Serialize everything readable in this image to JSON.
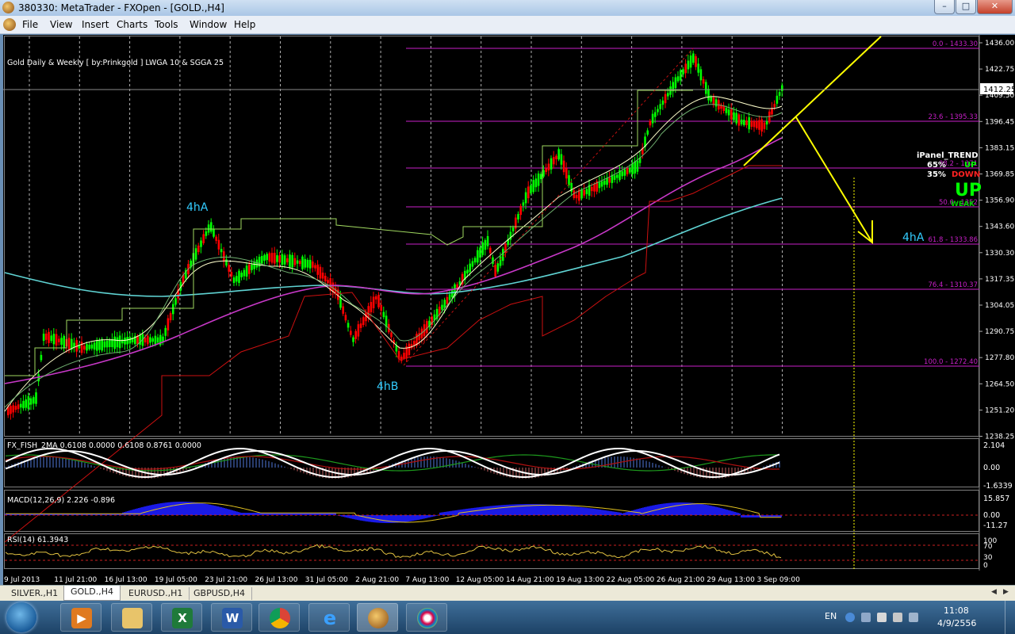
{
  "window": {
    "title": "380330: MetaTrader - FXOpen - [GOLD.,H4]",
    "minimize_label": "–",
    "maximize_label": "□",
    "close_label": "✕"
  },
  "menu": {
    "items": [
      "File",
      "View",
      "Insert",
      "Charts",
      "Tools",
      "Window",
      "Help"
    ]
  },
  "chart": {
    "indicator_title": "Gold Daily & Weekly  [ by:Prinkgold ]  LWGA 10  &  SGGA 25",
    "current_price": "1412.25",
    "price_axis": [
      "1436.00",
      "1422.75",
      "1409.50",
      "1396.45",
      "1383.15",
      "1369.85",
      "1356.90",
      "1343.60",
      "1330.30",
      "1317.35",
      "1304.05",
      "1290.75",
      "1277.80",
      "1264.50",
      "1251.20",
      "1238.25"
    ],
    "date_axis": [
      "9 Jul 2013",
      "11 Jul 21:00",
      "16 Jul 13:00",
      "19 Jul 05:00",
      "23 Jul 21:00",
      "26 Jul 13:00",
      "31 Jul 05:00",
      "2 Aug 21:00",
      "7 Aug 13:00",
      "12 Aug 05:00",
      "14 Aug 21:00",
      "19 Aug 13:00",
      "22 Aug 05:00",
      "26 Aug 21:00",
      "29 Aug 13:00",
      "3 Sep 09:00"
    ],
    "fib_levels": [
      "0.0 - 1433.30",
      "23.6 - 1395.33",
      "38.2 - 1371",
      "50.0 - 1352",
      "61.8 - 1333.86",
      "76.4 - 1310.37",
      "100.0 - 1272.40"
    ],
    "annotations": {
      "top_left": "4hA",
      "right": "4hA",
      "bottom": "4hB"
    },
    "ipanel": {
      "title": "iPanel_TREND",
      "up_pct": "65%",
      "up_label": "UP",
      "down_pct": "35%",
      "down_label": "DOWN",
      "trend": "UP",
      "strength": "WEAK"
    },
    "fisher": {
      "title": "FX_FISH_2MA 0.6108 0.0000 0.6108 0.8761 0.0000",
      "scale": [
        "2.104",
        "0.00",
        "-1.6339"
      ]
    },
    "macd": {
      "title": "MACD(12,26,9) 2.226 -0.896",
      "scale": [
        "15.857",
        "0.00",
        "-11.27"
      ]
    },
    "rsi": {
      "title": "RSI(14) 61.3943",
      "scale": [
        "100",
        "70",
        "30",
        "0"
      ]
    }
  },
  "tabs": [
    "SILVER.,H1",
    "GOLD.,H4",
    "EURUSD.,H1",
    "GBPUSD,H4"
  ],
  "active_tab": "GOLD.,H4",
  "taskbar": {
    "apps": [
      "media-player",
      "file-explorer",
      "excel",
      "word",
      "chrome",
      "internet-explorer",
      "metatrader",
      "paint"
    ]
  },
  "tray": {
    "language": "EN",
    "time": "11:08",
    "date": "4/9/2556"
  },
  "colors": {
    "bull": "#00ff00",
    "bear": "#ff0000",
    "fib": "#c71fc7",
    "trendline": "#ffff00",
    "ma_cyan": "#5fd3d3",
    "ma_magenta": "#c838c8",
    "annotation": "#33ccff"
  }
}
